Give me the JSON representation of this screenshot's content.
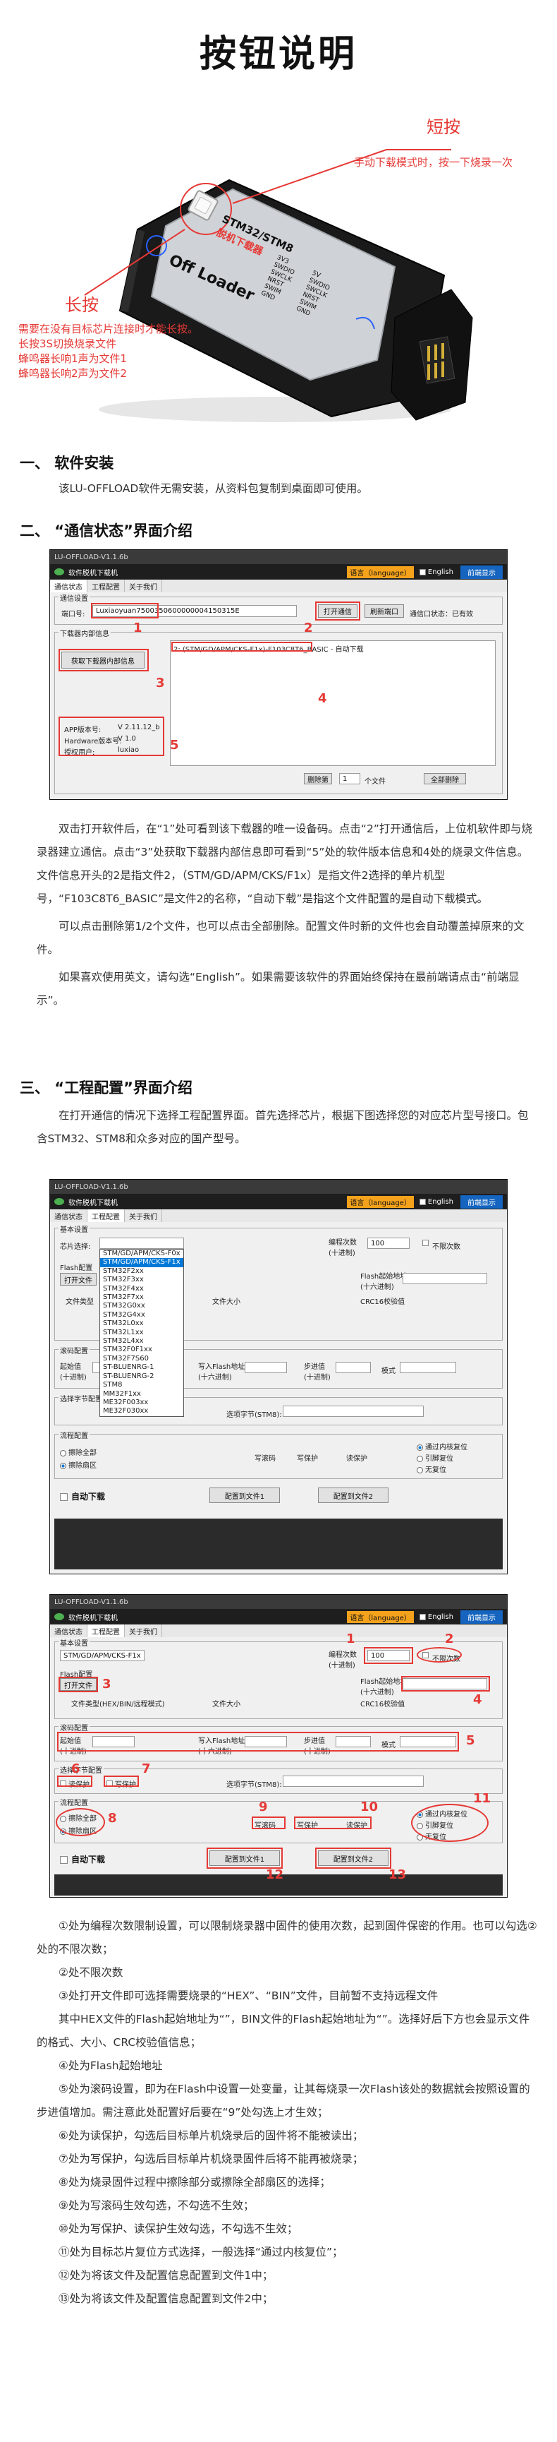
{
  "title": "按钮说明",
  "device": {
    "label_offloader": "Off Loader",
    "label_stm": "STM32/STM8",
    "label_chip": "脱机下载器",
    "pins": [
      "3V3",
      "SWDIO",
      "SWCLK",
      "NRST",
      "SWIM",
      "GND"
    ],
    "pins_right": [
      "5V",
      "SWDIO",
      "SWCLK",
      "NRST",
      "SWIM",
      "GND"
    ],
    "short_press_title": "短按",
    "short_press_desc": "手动下载模式时，按一下烧录一次",
    "long_press_title": "长按",
    "long_press_lines": [
      "需要在没有目标芯片连接时才能长按。",
      "长按3S切换烧录文件",
      "蜂鸣器长响1声为文件1",
      "蜂鸣器长响2声为文件2"
    ]
  },
  "section1": {
    "heading": "一、 软件安装",
    "text": "该LU-OFFLOAD软件无需安装，从资料包复制到桌面即可使用。"
  },
  "section2": {
    "heading": "二、 “通信状态”界面介绍",
    "paragraphs": [
      "双击打开软件后，在“1”处可看到该下载器的唯一设备码。点击“2”打开通信后，上位机软件即与烧录器建立通信。点击“3”处获取下载器内部信息即可看到“5”处的软件版本信息和4处的烧录文件信息。文件信息开头的2是指文件2，（STM/GD/APM/CKS/F1x）是指文件2选择的单片机型号，“F103C8T6_BASIC”是文件2的名称，“自动下载”是指这个文件配置的是自动下载模式。",
      "可以点击删除第1/2个文件，也可以点击全部删除。配置文件时新的文件也会自动覆盖掉原来的文件。",
      "如果喜欢使用英文，请勾选“English”。如果需要该软件的界面始终保持在最前端请点击“前端显示”。"
    ]
  },
  "section3": {
    "heading": "三、 “工程配置”界面介绍",
    "paragraphs": [
      "在打开通信的情况下选择工程配置界面。首先选择芯片，根据下图选择您的对应芯片型号接口。包含STM32、STM8和众多对应的国产型号。"
    ],
    "list": [
      "①处为编程次数限制设置，可以限制烧录器中固件的使用次数，起到固件保密的作用。也可以勾选②处的不限次数；",
      "②处不限次数",
      "③处打开文件即可选择需要烧录的“HEX”、“BIN”文件，目前暂不支持远程文件",
      "其中HEX文件的Flash起始地址为“”，BIN文件的Flash起始地址为“”。选择好后下方也会显示文件的格式、大小、CRC校验值信息；",
      "④处为Flash起始地址",
      "⑤处为滚码设置，即为在Flash中设置一处变量，让其每烧录一次Flash该处的数据就会按照设置的步进值增加。需注意此处配置好后要在“9”处勾选上才生效；",
      "⑥处为读保护，勾选后目标单片机烧录后的固件将不能被读出；",
      "⑦处为写保护，勾选后目标单片机烧录固件后将不能再被烧录；",
      "⑧处为烧录固件过程中擦除部分或擦除全部扇区的选择；",
      "⑨处为写滚码生效勾选，不勾选不生效；",
      "⑩处为写保护、读保护生效勾选，不勾选不生效；",
      "⑪处为目标芯片复位方式选择，一般选择“通过内核复位”；",
      "⑫处为将该文件及配置信息配置到文件1中；",
      "⑬处为将该文件及配置信息配置到文件2中；"
    ]
  },
  "win1": {
    "title": "LU-OFFLOAD-V1.1.6b",
    "app_name": "软件脱机下载机",
    "lang": "语言（language）",
    "english": "English",
    "front": "前端显示",
    "tabs": [
      "通信状态",
      "工程配置",
      "关于我们"
    ],
    "conn_group": "通信设置",
    "port_label": "端口号:",
    "port_value": "Luxiaoyuan7500350600000004150315E",
    "open_btn": "打开通信",
    "refresh_btn": "刷新端口",
    "status_label": "通信口状态：已有效",
    "info_group": "下载器内部信息",
    "get_info_btn": "获取下载器内部信息",
    "file_info": "2: (STM/GD/APM/CKS-F1x)-F103C8T6_BASIC - 自动下载",
    "version_rows": [
      {
        "k": "APP版本号:",
        "v": "V 2.11.12_b"
      },
      {
        "k": "Hardware版本号:",
        "v": "V 1.0"
      },
      {
        "k": "授权用户:",
        "v": "luxiao"
      }
    ],
    "delete_btn": "删除第",
    "file_count": "1",
    "file_unit": "个文件",
    "delete_all_btn": "全部删除",
    "nums": [
      "1",
      "2",
      "3",
      "4",
      "5"
    ]
  },
  "win2": {
    "title": "LU-OFFLOAD-V1.1.6b",
    "basic_group": "基本设置",
    "chip_label": "芯片选择:",
    "flash_cfg": "Flash配置",
    "open_file_btn": "打开文件",
    "prog_count_label": "编程次数\n(十进制)",
    "prog_count_value": "100",
    "unlimited_label": "不限次数",
    "file_type_label": "文件类型",
    "file_size_label": "文件大小",
    "crc_label": "CRC16校验值",
    "flash_addr_label": "Flash起始地址\n(十六进制)",
    "roll_group": "滚码配置",
    "roll_start_label": "起始值\n(十进制)",
    "roll_addr_label": "写入Flash地址\n(十六进制)",
    "step_label": "步进值\n(十进制)",
    "mode_label": "模式",
    "cmd_group": "选择字节配置",
    "read_protect": "读保护",
    "write_protect": "写保护",
    "stm8_label": "选项字节(STM8):",
    "flow_group": "流程配置",
    "erase_part": "擦除全部",
    "erase_all": "擦除扇区",
    "write_roll": "写滚码",
    "write_protect2": "写保护",
    "read_protect2": "读保护",
    "reset_kernel": "通过内核复位",
    "reset_pin": "引脚复位",
    "no_reset": "无复位",
    "auto_download": "自动下载",
    "cfg_file1": "配置到文件1",
    "cfg_file2": "配置到文件2",
    "chip_options": [
      "STM/GD/APM/CKS-F0x",
      "STM/GD/APM/CKS-F1x",
      "STM32F2xx",
      "STM32F3xx",
      "STM32F4xx",
      "STM32F7xx",
      "STM32G0xx",
      "STM32G4xx",
      "STM32L0xx",
      "STM32L1xx",
      "STM32L4xx",
      "STM32F0F1xx",
      "STM32F7S60",
      "ST-BLUENRG-1",
      "ST-BLUENRG-2",
      "STM8",
      "MM32F1xx",
      "ME32F003xx",
      "ME32F030xx"
    ],
    "chip_selected": "STM/GD/APM/CKS-F1x"
  },
  "win3": {
    "title": "LU-OFFLOAD-V1.1.6b",
    "chip_value": "STM/GD/APM/CKS-F1x",
    "file_hint": "文件类型(HEX/BIN/远程模式)",
    "nums": [
      "1",
      "2",
      "3",
      "4",
      "5",
      "6",
      "7",
      "8",
      "9",
      "10",
      "11",
      "12",
      "13"
    ]
  }
}
